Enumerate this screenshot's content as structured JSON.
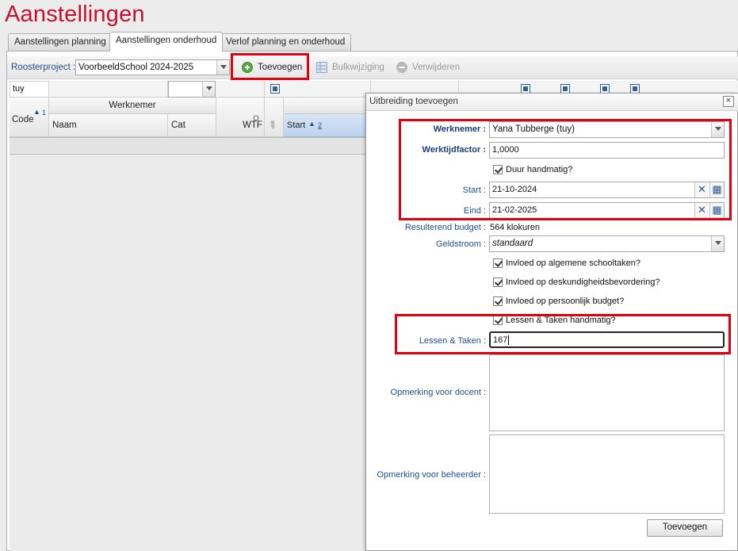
{
  "page_title": "Aanstellingen",
  "tabs": [
    {
      "label": "Aanstellingen planning"
    },
    {
      "label": "Aanstellingen onderhoud"
    },
    {
      "label": "Verlof planning en onderhoud"
    }
  ],
  "toolbar": {
    "project_label": "Roosterproject :",
    "project_value": "VoorbeeldSchool 2024-2025",
    "add_label": "Toevoegen",
    "bulk_label": "Bulkwijziging",
    "delete_label": "Verwijderen"
  },
  "grid": {
    "filter_value": "tuy",
    "group_header": "Werknemer",
    "columns": {
      "code": "Code",
      "code_sort": "1",
      "naam": "Naam",
      "cat": "Cat",
      "wtf": "WTF",
      "start": "Start",
      "start_sort": "2"
    }
  },
  "dialog": {
    "title": "Uitbreiding toevoegen",
    "werknemer_label": "Werknemer :",
    "werknemer_value": "Yana Tubberge (tuy)",
    "werktijdfactor_label": "Werktijdfactor :",
    "werktijdfactor_value": "1,0000",
    "duur_label": "Duur handmatig?",
    "start_label": "Start :",
    "start_value": "21-10-2024",
    "eind_label": "Eind :",
    "eind_value": "21-02-2025",
    "budget_label": "Resulterend budget :",
    "budget_value": "564 klokuren",
    "geldstroom_label": "Geldstroom :",
    "geldstroom_value": "standaard",
    "cb_algemeen": "Invloed op algemene schooltaken?",
    "cb_deskundigheid": "Invloed op deskundigheidsbevordering?",
    "cb_persoonlijk": "Invloed op persoonlijk budget?",
    "cb_lessen": "Lessen & Taken handmatig?",
    "lessen_label": "Lessen & Taken :",
    "lessen_value": "167",
    "opm_docent_label": "Opmerking voor docent :",
    "opm_beheerder_label": "Opmerking voor beheerder :",
    "submit_label": "Toevoegen"
  },
  "colors": {
    "title_red": "#c8102e",
    "highlight_red": "#e2000f",
    "label_blue": "#1d4f91"
  }
}
